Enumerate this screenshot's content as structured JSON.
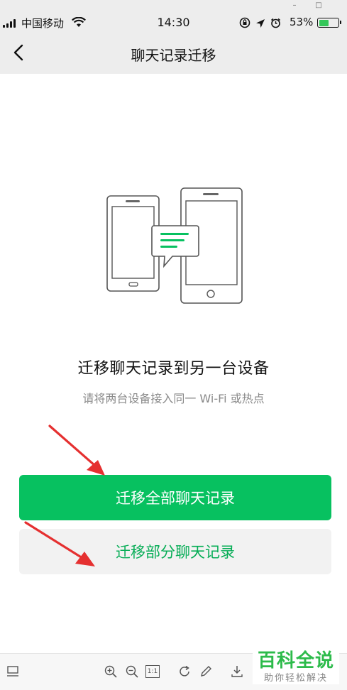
{
  "status_bar": {
    "carrier": "中国移动",
    "time": "14:30",
    "battery_percent": "53%",
    "battery_level": 0.53,
    "battery_color": "#34c759",
    "icons": [
      "signal-icon",
      "wifi-icon",
      "orientation-lock-icon",
      "location-icon",
      "alarm-icon",
      "battery-icon"
    ]
  },
  "window_controls": {
    "minimize": "–",
    "maximize": "□"
  },
  "nav": {
    "back_icon": "chevron-left-icon",
    "title": "聊天记录迁移"
  },
  "main": {
    "illustration_icon": "phone-to-tablet-chat-icon",
    "heading": "迁移聊天记录到另一台设备",
    "subheading": "请将两台设备接入同一 Wi-Fi 或热点",
    "primary_button": "迁移全部聊天记录",
    "secondary_button": "迁移部分聊天记录"
  },
  "colors": {
    "accent_green": "#07c160",
    "secondary_text_green": "#06ad56",
    "annotation_red": "#e53030"
  },
  "toolbar": {
    "icons": [
      "layout-icon",
      "zoom-in-icon",
      "zoom-out-icon",
      "actual-size-icon",
      "rotate-icon",
      "edit-pen-icon",
      "download-icon"
    ],
    "actual_size_label": "1:1"
  },
  "watermark": {
    "main": "百科全说",
    "sub": "助你轻松解决"
  }
}
